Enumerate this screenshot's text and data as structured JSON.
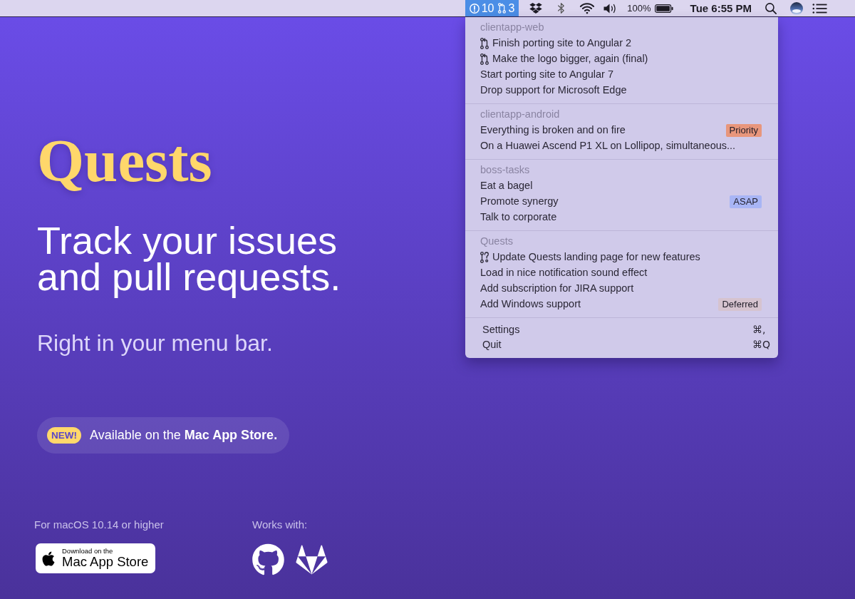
{
  "menu_bar": {
    "status_item": {
      "selected": true,
      "issue_count": "10",
      "pull_request_count": "3"
    },
    "battery": "100%",
    "clock": "Tue 6:55 PM"
  },
  "dropdown": {
    "sections": [
      {
        "title": "clientapp-web",
        "items": [
          {
            "kind": "pull_request",
            "label": "Finish porting site to Angular 2"
          },
          {
            "kind": "pull_request",
            "label": "Make the logo bigger, again (final)"
          },
          {
            "kind": "issue",
            "label": "Start porting site to Angular 7"
          },
          {
            "kind": "issue",
            "label": "Drop support for Microsoft Edge"
          }
        ]
      },
      {
        "title": "clientapp-android",
        "items": [
          {
            "kind": "issue",
            "label": "Everything is broken and on fire",
            "tag": {
              "label": "Priority",
              "color": "#e8967c"
            }
          },
          {
            "kind": "issue",
            "label": "On a Huawei Ascend P1 XL on Lollipop, simultaneous..."
          }
        ]
      },
      {
        "title": "boss-tasks",
        "items": [
          {
            "kind": "issue",
            "label": "Eat a bagel"
          },
          {
            "kind": "issue",
            "label": "Promote synergy",
            "tag": {
              "label": "ASAP",
              "color": "#a8b5f5"
            }
          },
          {
            "kind": "issue",
            "label": "Talk to corporate"
          }
        ]
      },
      {
        "title": "Quests",
        "items": [
          {
            "kind": "draft_pull_request",
            "label": "Update Quests landing page for new features"
          },
          {
            "kind": "issue",
            "label": "Load in nice notification sound effect"
          },
          {
            "kind": "issue",
            "label": "Add subscription for JIRA support"
          },
          {
            "kind": "issue",
            "label": "Add Windows support",
            "tag": {
              "label": "Deferred",
              "color": "#d6c3cf"
            }
          }
        ]
      }
    ],
    "actions": [
      {
        "label": "Settings",
        "shortcut": "⌘,"
      },
      {
        "label": "Quit",
        "shortcut": "⌘Q"
      }
    ]
  },
  "hero": {
    "logo": "Quests",
    "headline": "Track your issues and pull requests.",
    "subtitle": "Right in your menu bar."
  },
  "announcement": {
    "badge": "NEW!",
    "text": "Available on the **Mac App Store.**"
  },
  "footer": {
    "requirement": "For macOS 10.14 or higher",
    "store_badge": {
      "caption": "Download on the",
      "title": "Mac App Store"
    },
    "works_with": "Works with:"
  }
}
